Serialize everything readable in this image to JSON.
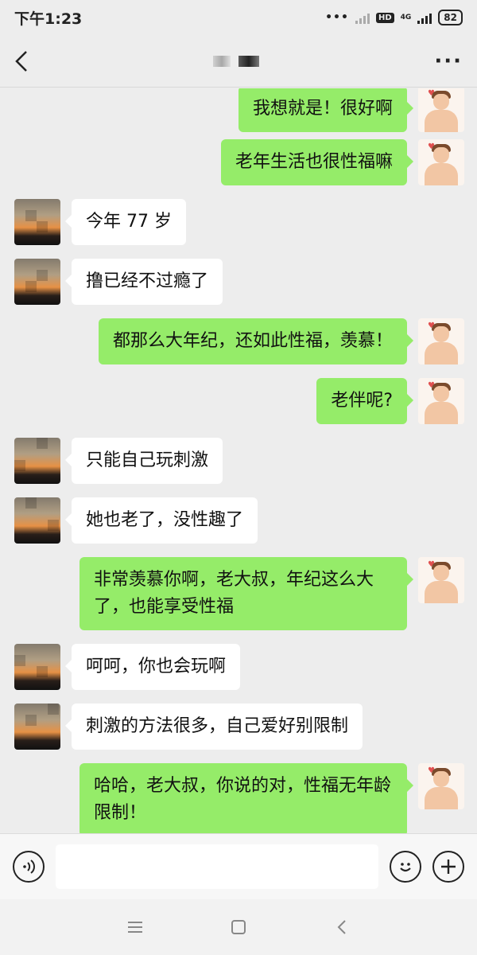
{
  "status_bar": {
    "time": "下午1:23",
    "network": "4G",
    "hd": "HD",
    "battery": "82"
  },
  "header": {
    "title": "",
    "more": "···"
  },
  "messages": [
    {
      "side": "right",
      "text": "我想就是！很好啊"
    },
    {
      "side": "right",
      "text": "老年生活也很性福嘛"
    },
    {
      "side": "left",
      "text": "今年 77 岁"
    },
    {
      "side": "left",
      "text": "撸已经不过瘾了"
    },
    {
      "side": "right",
      "text": "都那么大年纪，还如此性福，羡慕！"
    },
    {
      "side": "right",
      "text": "老伴呢?"
    },
    {
      "side": "left",
      "text": "只能自己玩刺激"
    },
    {
      "side": "left",
      "text": "她也老了，没性趣了"
    },
    {
      "side": "right",
      "text": "非常羡慕你啊，老大叔，年纪这么大了，也能享受性福"
    },
    {
      "side": "left",
      "text": "呵呵，你也会玩啊"
    },
    {
      "side": "left",
      "text": "刺激的方法很多，自己爱好别限制"
    },
    {
      "side": "right",
      "text": "哈哈，老大叔，你说的对，性福无年龄限制！"
    }
  ],
  "input": {
    "value": "",
    "placeholder": ""
  },
  "icons": {
    "back": "chevron-left-icon",
    "more": "more-dots-icon",
    "voice": "voice-icon",
    "emoji": "emoji-icon",
    "add": "plus-icon",
    "nav_menu": "menu-icon",
    "nav_home": "home-icon",
    "nav_back": "back-icon"
  },
  "colors": {
    "background": "#ededed",
    "self_bubble": "#95ec69",
    "other_bubble": "#ffffff"
  }
}
